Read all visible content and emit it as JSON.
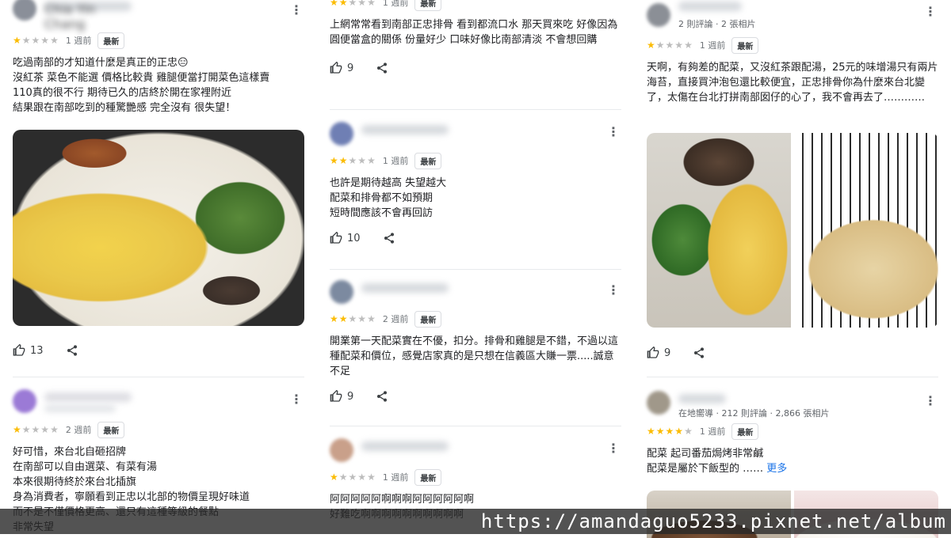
{
  "colors": {
    "star_on": "#fbbc04",
    "star_off": "#bdbdbd",
    "link": "#1a73e8"
  },
  "icons": {
    "like": "thumbs-up-icon",
    "share": "share-icon",
    "more": "more-vert-icon"
  },
  "columns": [
    {
      "reviews": [
        {
          "reviewer_name": "Chia Yin Chang",
          "rating": 1,
          "time": "1 週前",
          "badge": "最新",
          "text": "吃過南部的才知道什麼是真正的正忠😑\n沒紅茶 菜色不能選 價格比較貴 雞腿便當打開菜色這樣賣\n110真的很不行 期待已久的店終於開在家裡附近\n結果跟在南部吃到的種驚艷感 完全沒有 很失望！",
          "likes": "13"
        },
        {
          "rating": 1,
          "time": "2 週前",
          "badge": "最新",
          "text": "好可惜，來台北自砸招牌\n在南部可以自由選菜、有菜有湯\n本來很期待終於來台北插旗\n身為消費者，寧願看到正忠以北部的物價呈現好味道\n而不是不僅價格更高、還只有這種等級的餐點\n非常失望"
        }
      ]
    },
    {
      "reviews": [
        {
          "rating": 2,
          "time": "1 週前",
          "badge": "最新",
          "text": "上網常常看到南部正忠排骨 看到都流口水 那天買來吃 好像因為圓便當盒的關係 份量好少 口味好像比南部清淡 不會想回購",
          "likes": "9"
        },
        {
          "rating": 2,
          "time": "1 週前",
          "badge": "最新",
          "text": "也許是期待越高 失望越大\n配菜和排骨都不如預期\n短時間應該不會再回訪",
          "likes": "10"
        },
        {
          "rating": 2,
          "time": "2 週前",
          "badge": "最新",
          "text": "開業第一天配菜實在不優，扣分。排骨和雞腿是不錯，不過以這種配菜和價位，感覺店家真的是只想在信義區大賺一票.....誠意不足",
          "likes": "9"
        },
        {
          "rating": 1,
          "time": "1 週前",
          "badge": "最新",
          "text": "阿阿阿阿阿啊啊啊阿阿阿阿阿啊\n好難吃啊啊啊啊啊啊啊啊啊啊"
        }
      ]
    },
    {
      "reviews": [
        {
          "reviewer_meta": "2 則評論 · 2 張相片",
          "rating": 1,
          "time": "1 週前",
          "badge": "最新",
          "text": "天啊，有夠差的配菜，又沒紅茶跟配湯，25元的味增湯只有兩片海苔，直接買沖泡包還比較便宜，正忠排骨你為什麼來台北變了，太傷在台北打拼南部囡仔的心了，我不會再去了…………",
          "likes": "9"
        },
        {
          "reviewer_meta": "在地嚮導 · 212 則評論 · 2,866 張相片",
          "rating": 4,
          "time": "1 週前",
          "badge": "最新",
          "text": "配菜 起司番茄焗烤非常鹹\n配菜是屬於下飯型的 ……",
          "more_label": "更多"
        }
      ]
    }
  ],
  "watermark": "https://amandaguo5233.pixnet.net/album"
}
